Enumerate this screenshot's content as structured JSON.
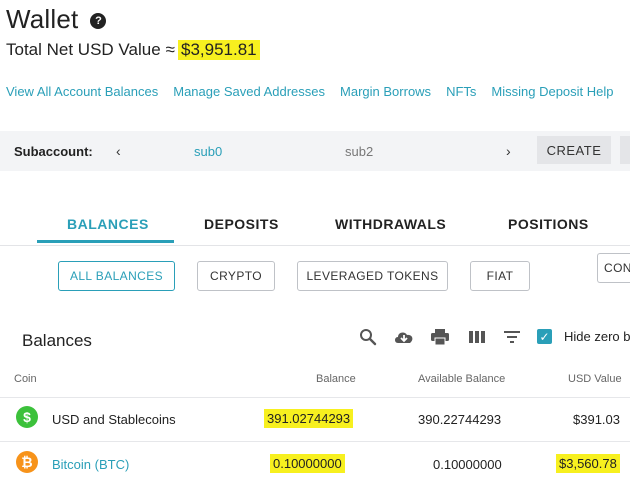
{
  "header": {
    "title": "Wallet",
    "help_icon": "?",
    "total_label": "Total Net USD Value",
    "approx_symbol": "≈",
    "total_value": "$3,951.81"
  },
  "links": [
    "View All Account Balances",
    "Manage Saved Addresses",
    "Margin Borrows",
    "NFTs",
    "Missing Deposit Help"
  ],
  "subaccount": {
    "label": "Subaccount:",
    "prev": "‹",
    "next": "›",
    "items": [
      "sub0",
      "sub2"
    ],
    "create_label": "CREATE"
  },
  "tabs": [
    {
      "label": "BALANCES",
      "active": true
    },
    {
      "label": "DEPOSITS",
      "active": false
    },
    {
      "label": "WITHDRAWALS",
      "active": false
    },
    {
      "label": "POSITIONS",
      "active": false
    }
  ],
  "filters": [
    {
      "label": "ALL BALANCES",
      "active": true
    },
    {
      "label": "CRYPTO",
      "active": false
    },
    {
      "label": "LEVERAGED TOKENS",
      "active": false
    },
    {
      "label": "FIAT",
      "active": false
    },
    {
      "label": "CON",
      "active": false
    }
  ],
  "balances": {
    "title": "Balances",
    "hide_zero_label": "Hide zero b",
    "hide_zero_checked": true,
    "columns": {
      "coin": "Coin",
      "balance": "Balance",
      "available": "Available Balance",
      "usd": "USD Value"
    },
    "rows": [
      {
        "icon": "$",
        "icon_color": "#3cc13b",
        "name": "USD and Stablecoins",
        "balance": "391.02744293",
        "available": "390.22744293",
        "usd": "$391.03"
      },
      {
        "icon": "₿",
        "icon_color": "#f7931a",
        "name": "Bitcoin (BTC)",
        "balance": "0.10000000",
        "available": "0.10000000",
        "usd": "$3,560.78"
      }
    ]
  },
  "colors": {
    "accent": "#2a9fb8",
    "highlight": "#f7f01f"
  }
}
